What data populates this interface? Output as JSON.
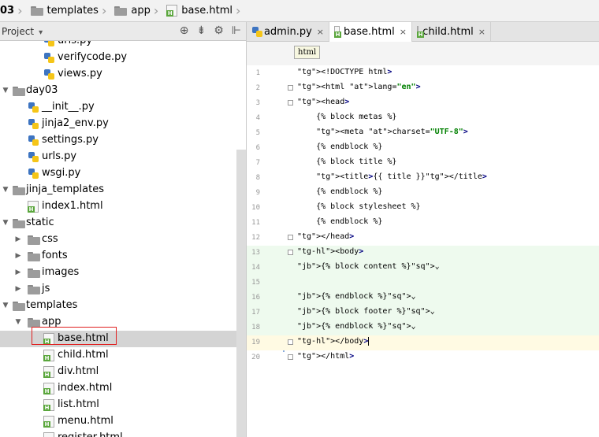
{
  "breadcrumb": [
    {
      "label": "03",
      "icon": "none"
    },
    {
      "label": "templates",
      "icon": "folder-icon"
    },
    {
      "label": "app",
      "icon": "folder-icon"
    },
    {
      "label": "base.html",
      "icon": "html-file-icon"
    }
  ],
  "project_panel": {
    "title": "Project",
    "tools": [
      "gear-target-icon",
      "collapse-icon",
      "settings-icon",
      "hide-icon"
    ]
  },
  "tree": [
    {
      "label": "urls.py",
      "icon": "python-file-icon",
      "level": 2
    },
    {
      "label": "verifycode.py",
      "icon": "python-file-icon",
      "level": 2
    },
    {
      "label": "views.py",
      "icon": "python-file-icon",
      "level": 2
    },
    {
      "label": "day03",
      "icon": "folder-icon",
      "level": 0,
      "expanded": true
    },
    {
      "label": "__init__.py",
      "icon": "python-file-icon",
      "level": 1
    },
    {
      "label": "jinja2_env.py",
      "icon": "python-file-icon",
      "level": 1
    },
    {
      "label": "settings.py",
      "icon": "python-file-icon",
      "level": 1
    },
    {
      "label": "urls.py",
      "icon": "python-file-icon",
      "level": 1
    },
    {
      "label": "wsgi.py",
      "icon": "python-file-icon",
      "level": 1
    },
    {
      "label": "jinja_templates",
      "icon": "folder-icon",
      "level": 0,
      "expanded": true
    },
    {
      "label": "index1.html",
      "icon": "html-file-icon",
      "level": 1
    },
    {
      "label": "static",
      "icon": "folder-icon",
      "level": 0,
      "expanded": true
    },
    {
      "label": "css",
      "icon": "folder-icon",
      "level": 1,
      "expanded": false
    },
    {
      "label": "fonts",
      "icon": "folder-icon",
      "level": 1,
      "expanded": false
    },
    {
      "label": "images",
      "icon": "folder-icon",
      "level": 1,
      "expanded": false
    },
    {
      "label": "js",
      "icon": "folder-icon",
      "level": 1,
      "expanded": false
    },
    {
      "label": "templates",
      "icon": "folder-icon",
      "level": 0,
      "expanded": true
    },
    {
      "label": "app",
      "icon": "folder-icon",
      "level": 1,
      "expanded": true
    },
    {
      "label": "base.html",
      "icon": "html-file-icon",
      "level": 2,
      "selected": true
    },
    {
      "label": "child.html",
      "icon": "html-file-icon",
      "level": 2
    },
    {
      "label": "div.html",
      "icon": "html-file-icon",
      "level": 2
    },
    {
      "label": "index.html",
      "icon": "html-file-icon",
      "level": 2
    },
    {
      "label": "list.html",
      "icon": "html-file-icon",
      "level": 2
    },
    {
      "label": "menu.html",
      "icon": "html-file-icon",
      "level": 2
    },
    {
      "label": "register.html",
      "icon": "html-file-icon",
      "level": 2
    }
  ],
  "tabs": [
    {
      "label": "admin.py",
      "icon": "python-file-icon",
      "active": false
    },
    {
      "label": "base.html",
      "icon": "html-file-icon",
      "active": true
    },
    {
      "label": "child.html",
      "icon": "html-file-icon",
      "active": false
    }
  ],
  "tab_close": "×",
  "tooltip": "html",
  "code_lines": [
    {
      "n": "1",
      "text": "<!DOCTYPE html>"
    },
    {
      "n": "2",
      "text": "<html lang=\"en\">"
    },
    {
      "n": "3",
      "text": "<head>"
    },
    {
      "n": "4",
      "text": "    {% block metas %}"
    },
    {
      "n": "5",
      "text": "    <meta charset=\"UTF-8\">"
    },
    {
      "n": "6",
      "text": "    {% endblock %}"
    },
    {
      "n": "7",
      "text": "    {% block title %}"
    },
    {
      "n": "8",
      "text": "    <title>{{ title }}</title>"
    },
    {
      "n": "9",
      "text": "    {% endblock %}"
    },
    {
      "n": "10",
      "text": "    {% block stylesheet %}"
    },
    {
      "n": "11",
      "text": "    {% endblock %}"
    },
    {
      "n": "12",
      "text": "</head>"
    },
    {
      "n": "13",
      "text": "<body>"
    },
    {
      "n": "14",
      "text": "{% block content %}"
    },
    {
      "n": "15",
      "text": ""
    },
    {
      "n": "16",
      "text": "{% endblock %}"
    },
    {
      "n": "17",
      "text": "{% block footer %}"
    },
    {
      "n": "18",
      "text": "{% endblock %}"
    },
    {
      "n": "19",
      "text": "</body>"
    },
    {
      "n": "20",
      "text": "</html>"
    }
  ],
  "colors": {
    "tag": "#000080",
    "string": "#008000",
    "added_lines_bg": "#eefaee",
    "current_line_bg": "#fffae3",
    "selection_outline": "#e02020"
  }
}
